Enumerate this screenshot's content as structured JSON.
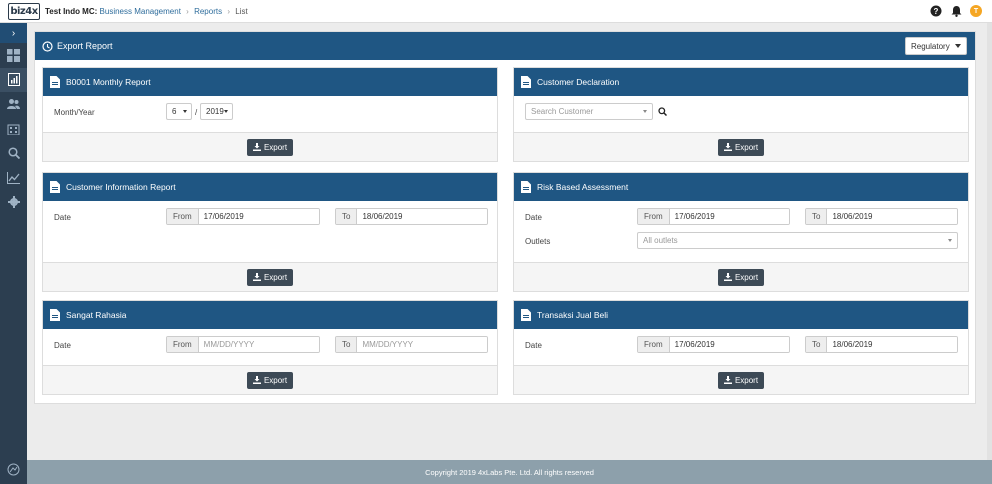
{
  "topbar": {
    "logo": "biz4x",
    "company": "Test Indo MC:",
    "crumbs": [
      "Business Management",
      "Reports",
      "List"
    ],
    "avatar_initial": "T"
  },
  "main": {
    "title": "Export Report",
    "regulatory_select": "Regulatory"
  },
  "cards": {
    "monthly": {
      "title": "B0001 Monthly Report",
      "label": "Month/Year",
      "month": "6",
      "slash": "/",
      "year": "2019",
      "export": "Export"
    },
    "declaration": {
      "title": "Customer Declaration",
      "search_placeholder": "Search Customer",
      "export": "Export"
    },
    "info": {
      "title": "Customer Information Report",
      "label": "Date",
      "from_label": "From",
      "from_value": "17/06/2019",
      "to_label": "To",
      "to_value": "18/06/2019",
      "export": "Export"
    },
    "risk": {
      "title": "Risk Based Assessment",
      "label": "Date",
      "from_label": "From",
      "from_value": "17/06/2019",
      "to_label": "To",
      "to_value": "18/06/2019",
      "outlets_label": "Outlets",
      "outlets_placeholder": "All outlets",
      "export": "Export"
    },
    "rahasia": {
      "title": "Sangat Rahasia",
      "label": "Date",
      "from_label": "From",
      "from_placeholder": "MM/DD/YYYY",
      "to_label": "To",
      "to_placeholder": "MM/DD/YYYY",
      "export": "Export"
    },
    "jual": {
      "title": "Transaksi Jual Beli",
      "label": "Date",
      "from_label": "From",
      "from_value": "17/06/2019",
      "to_label": "To",
      "to_value": "18/06/2019",
      "export": "Export"
    }
  },
  "footer": {
    "text": "Copyright 2019 4xLabs Pte. Ltd. All rights reserved"
  },
  "colors": {
    "header_blue": "#1f5683",
    "sidebar": "#2c3e50",
    "button": "#3d4a56",
    "footer": "#8da0ab",
    "avatar": "#f5a623"
  }
}
